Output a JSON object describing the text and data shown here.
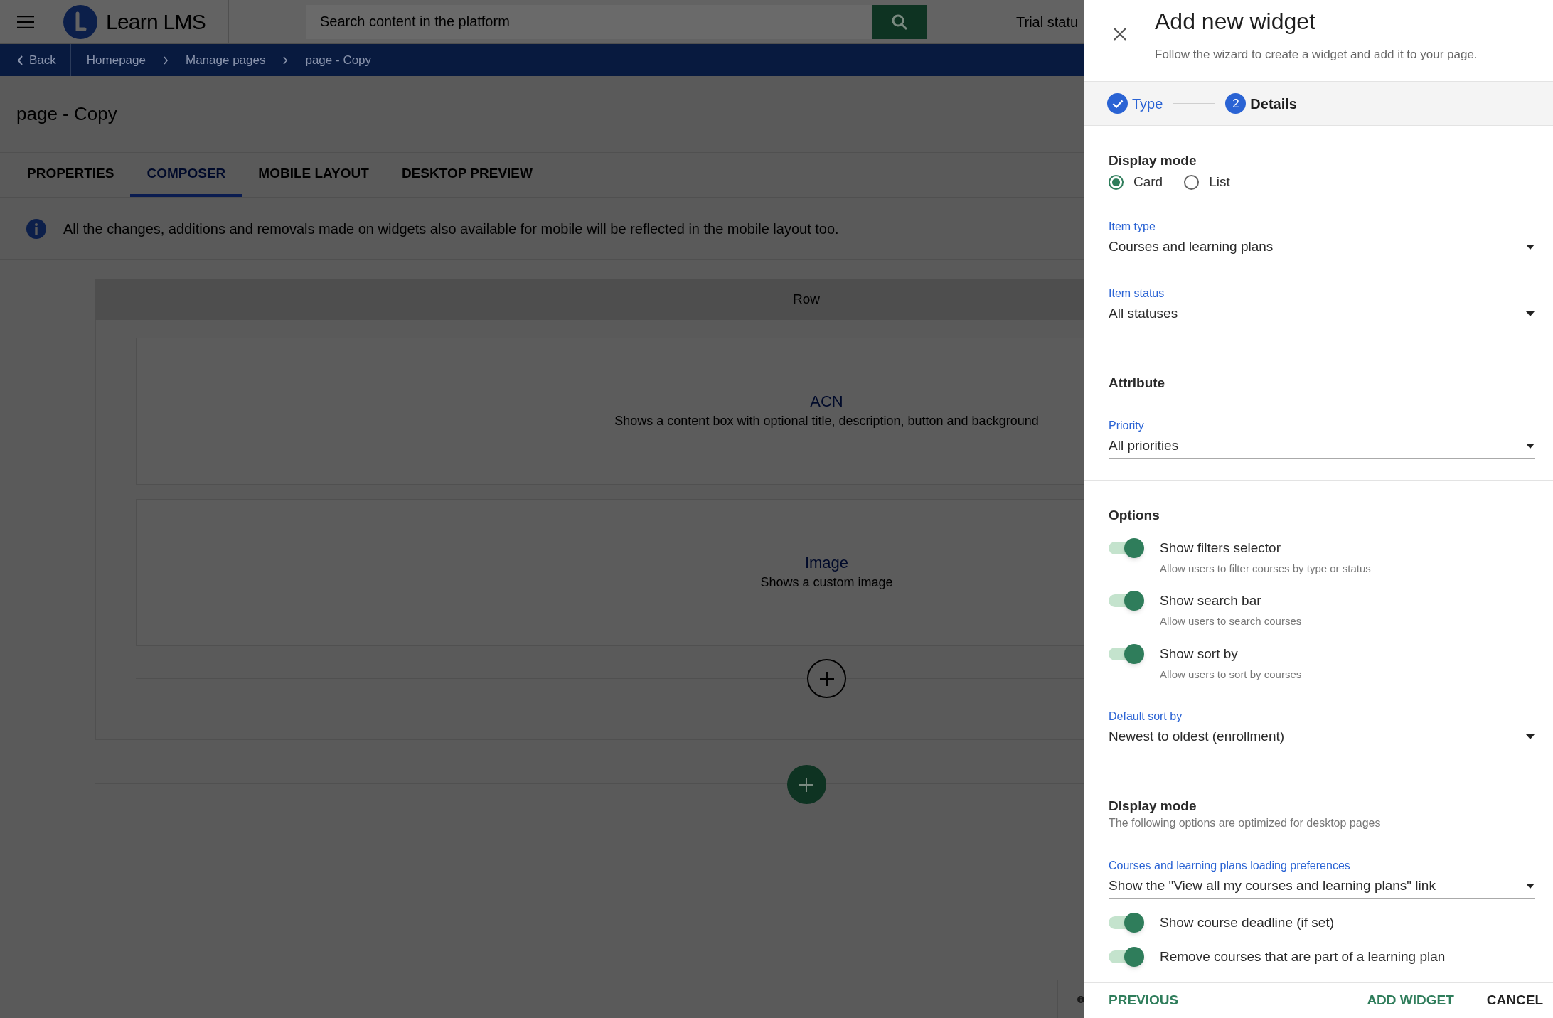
{
  "app_header": {
    "logo_text": "Learn LMS",
    "search": {
      "placeholder": "Search content in the platform"
    },
    "trial_status": "Trial statu"
  },
  "breadcrumb": {
    "back": "Back",
    "items": [
      "Homepage",
      "Manage pages",
      "page - Copy"
    ]
  },
  "page_title": "page - Copy",
  "tabs": [
    {
      "label": "PROPERTIES",
      "selected": false
    },
    {
      "label": "COMPOSER",
      "selected": true
    },
    {
      "label": "MOBILE LAYOUT",
      "selected": false
    },
    {
      "label": "DESKTOP PREVIEW",
      "selected": false
    }
  ],
  "notice": "All the changes, additions and removals made on widgets also available for mobile will be reflected in the mobile layout too.",
  "composer": {
    "row_label": "Row",
    "widgets": [
      {
        "title": "ACN",
        "description": "Shows a content box with optional title, description, button and background"
      },
      {
        "title": "Image",
        "description": "Shows a custom image"
      }
    ]
  },
  "panel": {
    "title": "Add new widget",
    "subtitle": "Follow the wizard to create a widget and add it to your page.",
    "steps": [
      {
        "label": "Type",
        "completed": true,
        "selected": false
      },
      {
        "label": "Details",
        "number": "2",
        "completed": false,
        "selected": true
      }
    ],
    "sections": [
      {
        "heading": "Display mode",
        "items": [
          {
            "kind": "radio_group",
            "options": [
              {
                "label": "Card",
                "selected": true
              },
              {
                "label": "List",
                "selected": false
              }
            ]
          },
          {
            "kind": "select",
            "label": "Item type",
            "value": "Courses and learning plans"
          },
          {
            "kind": "select",
            "label": "Item status",
            "value": "All statuses"
          }
        ]
      },
      {
        "heading": "Attribute",
        "items": [
          {
            "kind": "select",
            "label": "Priority",
            "value": "All priorities"
          }
        ]
      },
      {
        "heading": "Options",
        "items": [
          {
            "kind": "toggle",
            "label": "Show filters selector",
            "description": "Allow users to filter courses by type or status",
            "on": true
          },
          {
            "kind": "toggle",
            "label": "Show search bar",
            "description": "Allow users to search courses",
            "on": true
          },
          {
            "kind": "toggle",
            "label": "Show sort by",
            "description": "Allow users to sort by courses",
            "on": true
          },
          {
            "kind": "select",
            "label": "Default sort by",
            "value": "Newest to oldest (enrollment)"
          }
        ]
      },
      {
        "heading": "Display mode",
        "subheading": "The following options are optimized for desktop pages",
        "items": [
          {
            "kind": "select",
            "label": "Courses and learning plans loading preferences",
            "value": "Show the \"View all my courses and learning plans\" link"
          },
          {
            "kind": "toggle",
            "label": "Show course deadline (if set)",
            "on": true
          },
          {
            "kind": "toggle",
            "label": "Remove courses that are part of a learning plan",
            "on": true
          }
        ]
      }
    ],
    "buttons": [
      {
        "label": "PREVIOUS",
        "kind": "back"
      },
      {
        "label": "ADD WIDGET",
        "kind": "primary"
      },
      {
        "label": "CANCEL",
        "kind": "plain"
      }
    ]
  }
}
